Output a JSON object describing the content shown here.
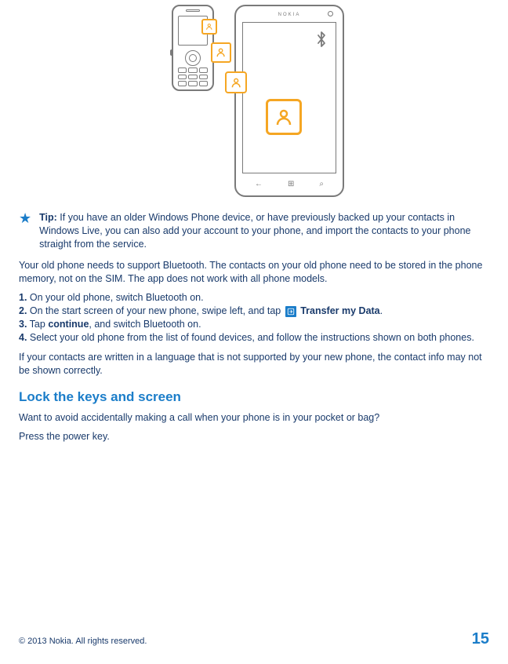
{
  "illustration": {
    "brand": "NOKIA",
    "nav_back": "←",
    "nav_home": "⊞",
    "nav_search": "⌕"
  },
  "tip": {
    "label": "Tip:",
    "text": " If you have an older Windows Phone device, or have previously backed up your contacts in Windows Live, you can also add your account to your phone, and import the contacts to your phone straight from the service."
  },
  "para1": "Your old phone needs to support Bluetooth. The contacts on your old phone need to be stored in the phone memory, not on the SIM. The app does not work with all phone models.",
  "steps": {
    "s1": {
      "num": "1.",
      "text": " On your old phone, switch Bluetooth on."
    },
    "s2": {
      "num": "2.",
      "pre": " On the start screen of your new phone, swipe left, and tap ",
      "app": "Transfer my Data",
      "post": "."
    },
    "s3": {
      "num": "3.",
      "pre": " Tap ",
      "bold": "continue",
      "post": ", and switch Bluetooth on."
    },
    "s4": {
      "num": "4.",
      "text": " Select your old phone from the list of found devices, and follow the instructions shown on both phones."
    }
  },
  "para2": "If your contacts are written in a language that is not supported by your new phone, the contact info may not be shown correctly.",
  "section_heading": "Lock the keys and screen",
  "section_p1": "Want to avoid accidentally making a call when your phone is in your pocket or bag?",
  "section_p2": "Press the power key.",
  "footer": {
    "copyright": "© 2013 Nokia. All rights reserved.",
    "page": "15"
  }
}
